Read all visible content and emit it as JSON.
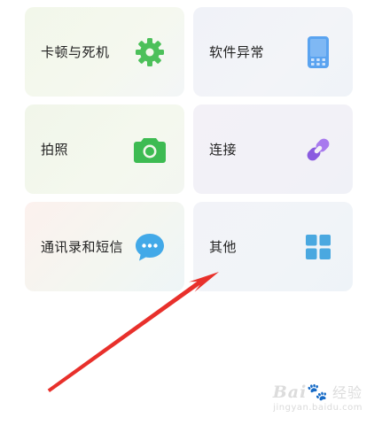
{
  "cards": [
    {
      "label": "卡顿与死机",
      "icon": "gear-icon",
      "color": "#4cc05a"
    },
    {
      "label": "软件异常",
      "icon": "phone-icon",
      "color": "#5aa3f0"
    },
    {
      "label": "拍照",
      "icon": "camera-icon",
      "color": "#3dbb52"
    },
    {
      "label": "连接",
      "icon": "link-icon",
      "color": "#8a5be0"
    },
    {
      "label": "通讯录和短信",
      "icon": "message-icon",
      "color": "#42a9e8"
    },
    {
      "label": "其他",
      "icon": "grid-icon",
      "color": "#4aa8e0"
    }
  ],
  "annotation": {
    "type": "arrow",
    "color": "#e8302b"
  },
  "watermark": {
    "brand": "Bai",
    "brand_cn": "经验",
    "url": "jingyan.baidu.com"
  }
}
